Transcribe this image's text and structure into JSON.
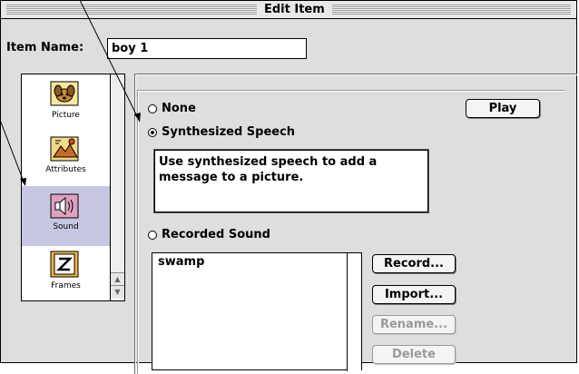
{
  "window": {
    "title": "Edit Item"
  },
  "item_name": {
    "label": "Item Name:",
    "value": "boy 1"
  },
  "icon_list": [
    {
      "caption": "Picture",
      "icon": "dog-picture-icon",
      "selected": false
    },
    {
      "caption": "Attributes",
      "icon": "attributes-icon",
      "selected": false
    },
    {
      "caption": "Sound",
      "icon": "speaker-icon",
      "selected": true
    },
    {
      "caption": "Frames",
      "icon": "film-frames-icon",
      "selected": false
    }
  ],
  "sound_options": {
    "none_label": "None",
    "synth_label": "Synthesized Speech",
    "recorded_label": "Recorded Sound",
    "selected": "Synthesized Speech"
  },
  "speech_text": "Use synthesized speech to add a message to a picture.",
  "buttons": {
    "play": "Play",
    "record": "Record...",
    "import": "Import...",
    "rename": "Rename...",
    "delete": "Delete"
  },
  "recorded_sounds": [
    "swamp"
  ],
  "colors": {
    "selected_item": "#c7c7e2",
    "window_bg": "#dedede"
  }
}
